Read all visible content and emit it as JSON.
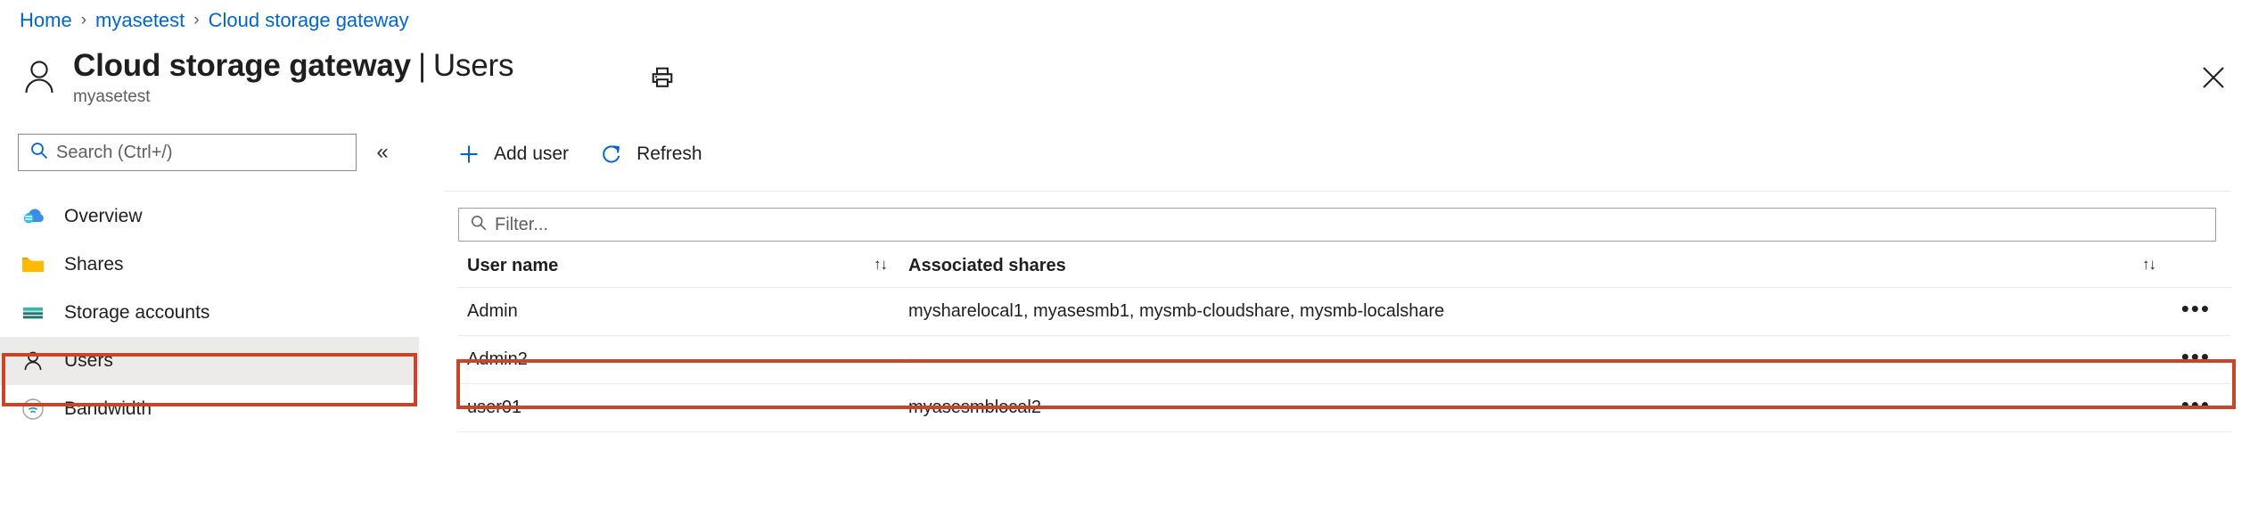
{
  "breadcrumb": {
    "items": [
      {
        "label": "Home"
      },
      {
        "label": "myasetest"
      },
      {
        "label": "Cloud storage gateway"
      }
    ],
    "separator": "›"
  },
  "header": {
    "icon": "user-outline-icon",
    "title": "Cloud storage gateway",
    "title_separator": "|",
    "title_section": "Users",
    "subtitle": "myasetest",
    "print_icon": "printer-icon",
    "close_icon": "close-icon"
  },
  "sidebar": {
    "search": {
      "placeholder": "Search (Ctrl+/)",
      "value": "",
      "icon": "search-icon"
    },
    "collapse_icon": "«",
    "items": [
      {
        "label": "Overview",
        "icon": "cloud-icon",
        "selected": false
      },
      {
        "label": "Shares",
        "icon": "folder-icon",
        "selected": false
      },
      {
        "label": "Storage accounts",
        "icon": "storage-account-icon",
        "selected": false
      },
      {
        "label": "Users",
        "icon": "user-icon",
        "selected": true
      },
      {
        "label": "Bandwidth",
        "icon": "bandwidth-icon",
        "selected": false
      }
    ]
  },
  "toolbar": {
    "add_user_label": "Add user",
    "add_user_icon": "plus-icon",
    "refresh_label": "Refresh",
    "refresh_icon": "refresh-icon"
  },
  "filter": {
    "placeholder": "Filter...",
    "value": "",
    "icon": "search-icon"
  },
  "table": {
    "columns": [
      {
        "label": "User name",
        "sort_icon": "↑↓"
      },
      {
        "label": "Associated shares",
        "sort_icon": "↑↓"
      }
    ],
    "rows": [
      {
        "user_name": "Admin",
        "associated_shares": "mysharelocal1, myasesmb1, mysmb-cloudshare, mysmb-localshare",
        "menu": "•••",
        "highlighted": false
      },
      {
        "user_name": "Admin2",
        "associated_shares": "-",
        "menu": "•••",
        "highlighted": true
      },
      {
        "user_name": "user01",
        "associated_shares": "myasesmblocal2",
        "menu": "•••",
        "highlighted": false
      }
    ]
  },
  "annotations": {
    "color": "#c8452a",
    "targets": [
      "sidebar-item-users",
      "table-row-admin2"
    ]
  }
}
